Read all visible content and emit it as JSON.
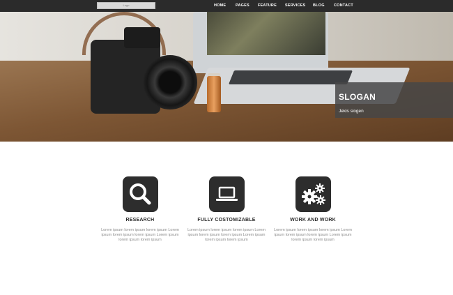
{
  "header": {
    "logo_text": "Logo",
    "nav": [
      {
        "label": "HOME"
      },
      {
        "label": "PAGES"
      },
      {
        "label": "FEATURE"
      },
      {
        "label": "SERVICES"
      },
      {
        "label": "BLOG"
      },
      {
        "label": "CONTACT"
      }
    ]
  },
  "hero": {
    "slogan": "SLOGAN",
    "subtitle": "Jekis slogen"
  },
  "features": [
    {
      "icon": "search-icon",
      "title": "RESEARCH",
      "text": "Lorem ipsum lorem ipsum lorem ipsum Lorem ipsum lorem ipsum lorem ipsum Lorem ipsum lorem ipsum lorem ipsum"
    },
    {
      "icon": "laptop-icon",
      "title": "FULLY COSTOMIZABLE",
      "text": "Lorem ipsum lorem ipsum lorem ipsum Lorem ipsum lorem ipsum lorem ipsum Lorem ipsum lorem ipsum lorem ipsum"
    },
    {
      "icon": "gears-icon",
      "title": "WORK AND WORK",
      "text": "Lorem ipsum lorem ipsum lorem ipsum Lorem ipsum lorem ipsum lorem ipsum Lorem ipsum lorem ipsum lorem ipsum"
    }
  ],
  "colors": {
    "topbar": "#2b2b2b",
    "icon_bg": "#2d2d2d",
    "slogan_box": "#464646",
    "body_text": "#8a8a8a"
  }
}
